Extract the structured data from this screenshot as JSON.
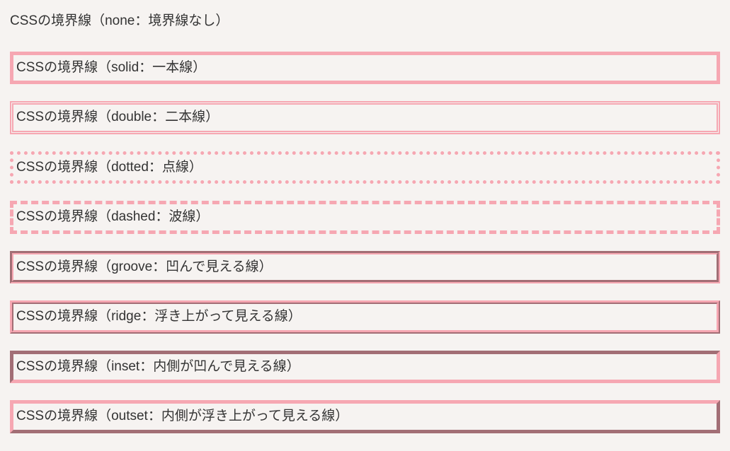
{
  "border_color": "#f6a7b2",
  "examples": [
    {
      "style": "none",
      "label": "CSSの境界線（none：境界線なし）"
    },
    {
      "style": "solid",
      "label": "CSSの境界線（solid：一本線）"
    },
    {
      "style": "double",
      "label": "CSSの境界線（double：二本線）"
    },
    {
      "style": "dotted",
      "label": "CSSの境界線（dotted：点線）"
    },
    {
      "style": "dashed",
      "label": "CSSの境界線（dashed：波線）"
    },
    {
      "style": "groove",
      "label": "CSSの境界線（groove：凹んで見える線）"
    },
    {
      "style": "ridge",
      "label": "CSSの境界線（ridge：浮き上がって見える線）"
    },
    {
      "style": "inset",
      "label": "CSSの境界線（inset：内側が凹んで見える線）"
    },
    {
      "style": "outset",
      "label": "CSSの境界線（outset：内側が浮き上がって見える線）"
    }
  ]
}
